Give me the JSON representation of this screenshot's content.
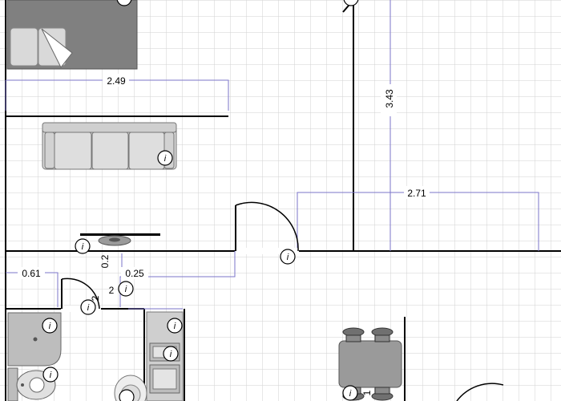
{
  "dimensions": {
    "d1": "2.49",
    "d2": "3.43",
    "d3": "2.71",
    "d4": "0.61",
    "d5": "0.25",
    "d6": "0.2",
    "d7": "2",
    "d8": "1"
  },
  "info_marker": "i",
  "colors": {
    "grid": "#cfcfcf",
    "wall": "#000000",
    "dimension": "#7b74c9",
    "furniture_dark": "#808080",
    "furniture_light": "#d4d4d4"
  }
}
